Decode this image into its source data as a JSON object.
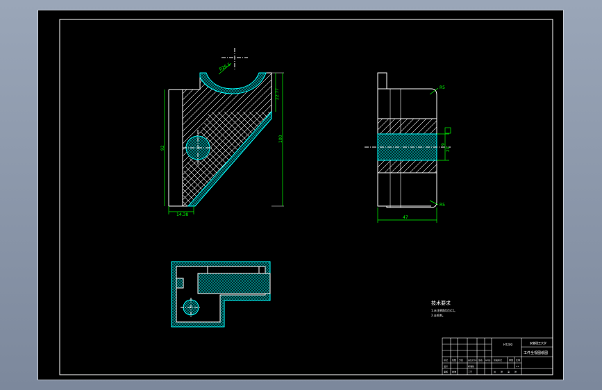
{
  "app": {
    "background_color": "#8a96aa",
    "paper_color": "#000000",
    "line_color": "#ffffff",
    "dimension_color": "#00ff00",
    "section_color": "#00ffff"
  },
  "drawing": {
    "front_view": {
      "dim_top_arc": "R26.5",
      "dim_right_upper": "22.77",
      "dim_right_total": "100",
      "dim_left_height": "92",
      "dim_bottom": "14.38"
    },
    "side_view": {
      "label_top_radius": "R5",
      "label_bottom_radius": "R5",
      "dim_hole_a": "9",
      "dim_hole_b": "20",
      "dim_width": "47"
    },
    "notes": {
      "heading": "技术要求",
      "line1": "1.未注倒角均为C1。",
      "line2": "2.去毛刺。"
    },
    "title_block": {
      "school": "安徽理工大学",
      "drawing_name": "工件全视图纸图",
      "material": "HT200",
      "cells": [
        "标记",
        "处数",
        "分区",
        "更改文件号",
        "签名",
        "年月日",
        "设计",
        "标准化",
        "审核",
        "工艺",
        "批准",
        "阶段标记",
        "重量",
        "比例",
        "1:1",
        "共",
        "张",
        "第",
        "张"
      ]
    }
  }
}
